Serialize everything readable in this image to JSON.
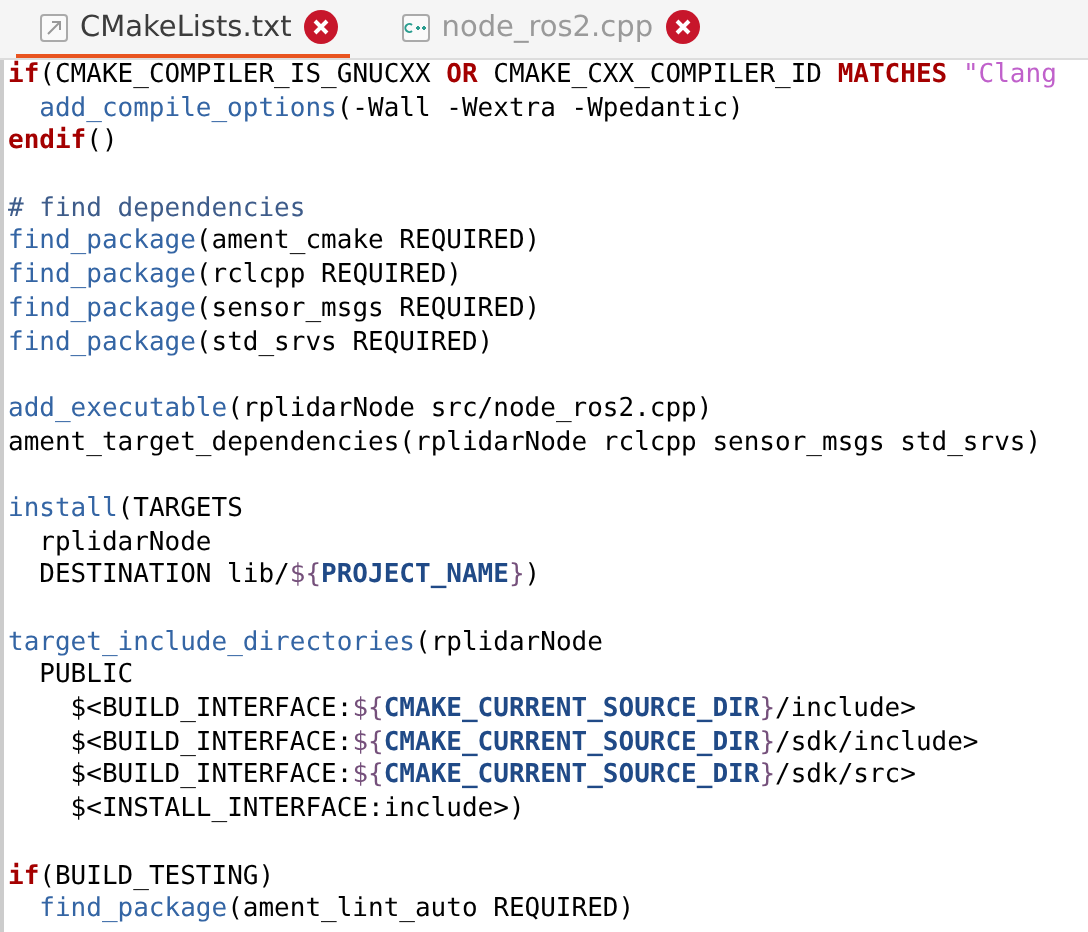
{
  "tabs": [
    {
      "label": "CMakeLists.txt",
      "kind": "text",
      "selected": true
    },
    {
      "label": "node_ros2.cpp",
      "kind": "cpp",
      "selected": false
    }
  ],
  "editor": {
    "blocks": [
      [
        {
          "tokens": [
            {
              "kind": "kw",
              "text": "if"
            },
            {
              "kind": "plain",
              "text": "(CMAKE_COMPILER_IS_GNUCXX "
            },
            {
              "kind": "kw",
              "text": "OR"
            },
            {
              "kind": "plain",
              "text": " CMAKE_CXX_COMPILER_ID "
            },
            {
              "kind": "kw",
              "text": "MATCHES"
            },
            {
              "kind": "str",
              "text": " \"Clang"
            }
          ],
          "children": [
            {
              "tokens": [
                {
                  "kind": "cmd",
                  "text": "add_compile_options"
                },
                {
                  "kind": "plain",
                  "text": "(-Wall -Wextra -Wpedantic)"
                }
              ]
            }
          ]
        },
        {
          "tokens": [
            {
              "kind": "kw",
              "text": "endif"
            },
            {
              "kind": "plain",
              "text": "()"
            }
          ]
        }
      ],
      [
        {
          "tokens": [
            {
              "kind": "comment",
              "text": "# find dependencies"
            }
          ]
        },
        {
          "tokens": [
            {
              "kind": "cmd",
              "text": "find_package"
            },
            {
              "kind": "plain",
              "text": "(ament_cmake REQUIRED)"
            }
          ]
        },
        {
          "tokens": [
            {
              "kind": "cmd",
              "text": "find_package"
            },
            {
              "kind": "plain",
              "text": "(rclcpp REQUIRED)"
            }
          ]
        },
        {
          "tokens": [
            {
              "kind": "cmd",
              "text": "find_package"
            },
            {
              "kind": "plain",
              "text": "(sensor_msgs REQUIRED)"
            }
          ]
        },
        {
          "tokens": [
            {
              "kind": "cmd",
              "text": "find_package"
            },
            {
              "kind": "plain",
              "text": "(std_srvs REQUIRED)"
            }
          ]
        }
      ],
      [
        {
          "tokens": [
            {
              "kind": "cmd",
              "text": "add_executable"
            },
            {
              "kind": "plain",
              "text": "(rplidarNode src/node_ros2.cpp)"
            }
          ]
        },
        {
          "tokens": [
            {
              "kind": "plain",
              "text": "ament_target_dependencies(rplidarNode rclcpp sensor_msgs std_srvs)"
            }
          ]
        }
      ],
      [
        {
          "tokens": [
            {
              "kind": "cmd",
              "text": "install"
            },
            {
              "kind": "plain",
              "text": "(TARGETS"
            }
          ],
          "children": [
            {
              "tokens": [
                {
                  "kind": "plain",
                  "text": "rplidarNode"
                }
              ]
            },
            {
              "tokens": [
                {
                  "kind": "plain",
                  "text": "DESTINATION lib/"
                },
                {
                  "kind": "delim",
                  "text": "${"
                },
                {
                  "kind": "var",
                  "text": "PROJECT_NAME"
                },
                {
                  "kind": "delim",
                  "text": "}"
                },
                {
                  "kind": "plain",
                  "text": ")"
                }
              ]
            }
          ]
        }
      ],
      [
        {
          "tokens": [
            {
              "kind": "cmd",
              "text": "target_include_directories"
            },
            {
              "kind": "plain",
              "text": "(rplidarNode"
            }
          ],
          "children": [
            {
              "tokens": [
                {
                  "kind": "plain",
                  "text": "PUBLIC"
                }
              ],
              "children": [
                {
                  "tokens": [
                    {
                      "kind": "plain",
                      "text": "$<BUILD_INTERFACE:"
                    },
                    {
                      "kind": "delim",
                      "text": "${"
                    },
                    {
                      "kind": "var",
                      "text": "CMAKE_CURRENT_SOURCE_DIR"
                    },
                    {
                      "kind": "delim",
                      "text": "}"
                    },
                    {
                      "kind": "plain",
                      "text": "/include>"
                    }
                  ]
                },
                {
                  "tokens": [
                    {
                      "kind": "plain",
                      "text": "$<BUILD_INTERFACE:"
                    },
                    {
                      "kind": "delim",
                      "text": "${"
                    },
                    {
                      "kind": "var",
                      "text": "CMAKE_CURRENT_SOURCE_DIR"
                    },
                    {
                      "kind": "delim",
                      "text": "}"
                    },
                    {
                      "kind": "plain",
                      "text": "/sdk/include>"
                    }
                  ]
                },
                {
                  "tokens": [
                    {
                      "kind": "plain",
                      "text": "$<BUILD_INTERFACE:"
                    },
                    {
                      "kind": "delim",
                      "text": "${"
                    },
                    {
                      "kind": "var",
                      "text": "CMAKE_CURRENT_SOURCE_DIR"
                    },
                    {
                      "kind": "delim",
                      "text": "}"
                    },
                    {
                      "kind": "plain",
                      "text": "/sdk/src>"
                    }
                  ]
                },
                {
                  "tokens": [
                    {
                      "kind": "plain",
                      "text": "$<INSTALL_INTERFACE:include>)"
                    }
                  ]
                }
              ]
            }
          ]
        }
      ],
      [
        {
          "tokens": [
            {
              "kind": "kw",
              "text": "if"
            },
            {
              "kind": "plain",
              "text": "(BUILD_TESTING)"
            }
          ],
          "children": [
            {
              "tokens": [
                {
                  "kind": "cmd",
                  "text": "find_package"
                },
                {
                  "kind": "plain",
                  "text": "(ament_lint_auto REQUIRED)"
                }
              ]
            }
          ]
        }
      ]
    ]
  }
}
